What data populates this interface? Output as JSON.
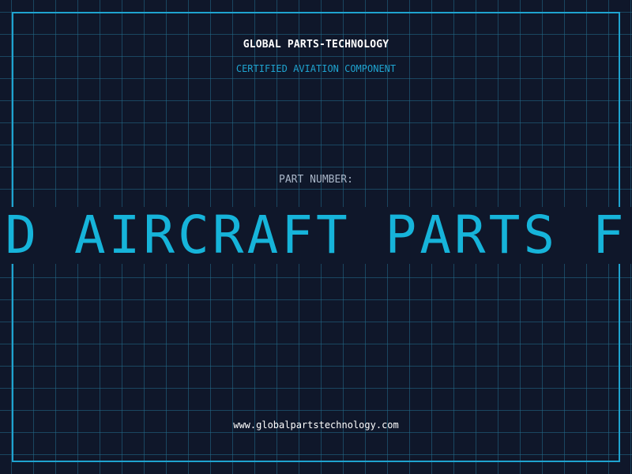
{
  "header": {
    "company_name": "GLOBAL PARTS-TECHNOLOGY",
    "tagline": "CERTIFIED AVIATION COMPONENT"
  },
  "part": {
    "label": "PART NUMBER:",
    "scrolling_text": "D AIRCRAFT PARTS F"
  },
  "footer": {
    "website": "www.globalpartstechnology.com"
  },
  "colors": {
    "background": "#0f172a",
    "grid": "#1d6e8c",
    "accent": "#1fa3cf",
    "marquee_text": "#16b4da",
    "heading": "#ffffff",
    "label": "#a9b6c8"
  }
}
